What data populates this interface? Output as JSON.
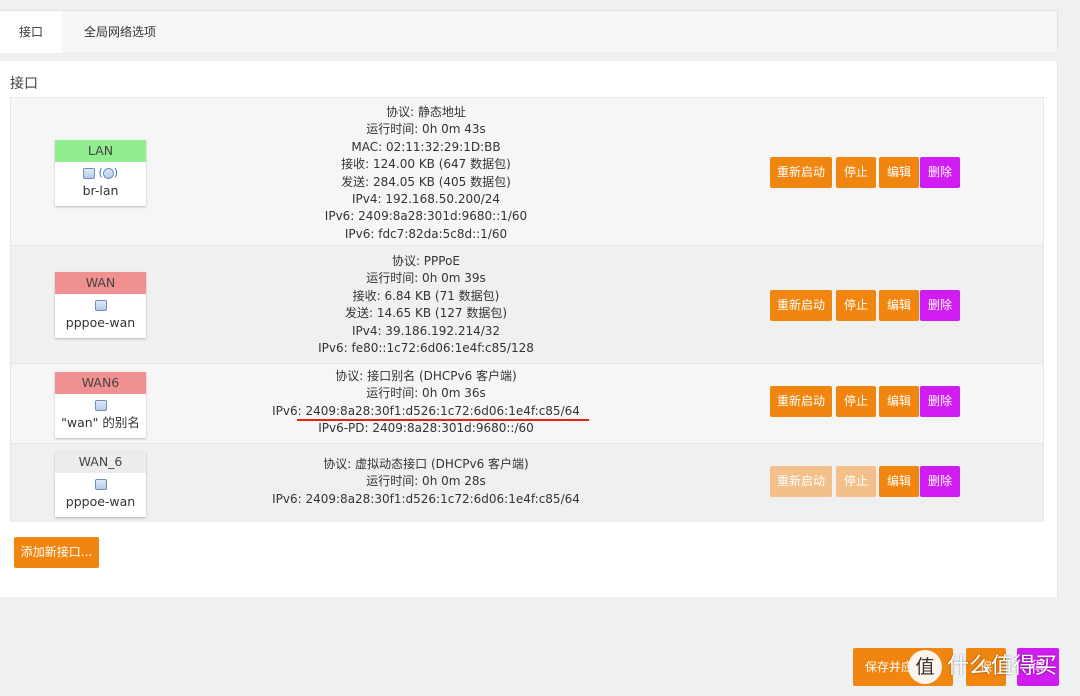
{
  "tabs": [
    {
      "label": "接口"
    },
    {
      "label": "全局网络选项"
    }
  ],
  "section_title": "接口",
  "colors": {
    "accent": "#f0860f",
    "danger": "#d01cf0",
    "lan": "#90ee90",
    "wan": "#f09090",
    "wan6_alias": "#ececec"
  },
  "buttons": {
    "restart": "重新启动",
    "stop": "停止",
    "edit": "编辑",
    "delete": "删除"
  },
  "interfaces": [
    {
      "name": "LAN",
      "device": "br-lan",
      "icons": [
        "bridge-icon",
        "ethernet-icon"
      ],
      "icons_text": "(",
      "lines": [
        "协议: 静态地址",
        "运行时间: 0h 0m 43s",
        "MAC: 02:11:32:29:1D:BB",
        "接收: 124.00 KB (647 数据包)",
        "发送: 284.05 KB (405 数据包)",
        "IPv4: 192.168.50.200/24",
        "IPv6: 2409:8a28:301d:9680::1/60",
        "IPv6: fdc7:82da:5c8d::1/60"
      ],
      "enabled": true
    },
    {
      "name": "WAN",
      "device": "pppoe-wan",
      "icons": [
        "tunnel-icon"
      ],
      "lines": [
        "协议: PPPoE",
        "运行时间: 0h 0m 39s",
        "接收: 6.84 KB (71 数据包)",
        "发送: 14.65 KB (127 数据包)",
        "IPv4: 39.186.192.214/32",
        "IPv6: fe80::1c72:6d06:1e4f:c85/128"
      ],
      "enabled": true
    },
    {
      "name": "WAN6",
      "device": "\"wan\" 的别名",
      "icons": [
        "alias-icon"
      ],
      "lines": [
        "协议: 接口别名 (DHCPv6 客户端)",
        "运行时间: 0h 0m 36s",
        "IPv6: 2409:8a28:30f1:d526:1c72:6d06:1e4f:c85/64",
        "IPv6-PD: 2409:8a28:301d:9680::/60"
      ],
      "enabled": true
    },
    {
      "name": "WAN_6",
      "device": "pppoe-wan",
      "icons": [
        "tunnel-icon"
      ],
      "lines": [
        "协议: 虚拟动态接口 (DHCPv6 客户端)",
        "运行时间: 0h 0m 28s",
        "IPv6: 2409:8a28:30f1:d526:1c72:6d06:1e4f:c85/64"
      ],
      "enabled": false
    }
  ],
  "add_button": "添加新接口...",
  "footer": {
    "save_apply": "保存并应",
    "save": "保",
    "reset": "得"
  },
  "watermark": {
    "logo": "值",
    "text": "什么值得买"
  }
}
